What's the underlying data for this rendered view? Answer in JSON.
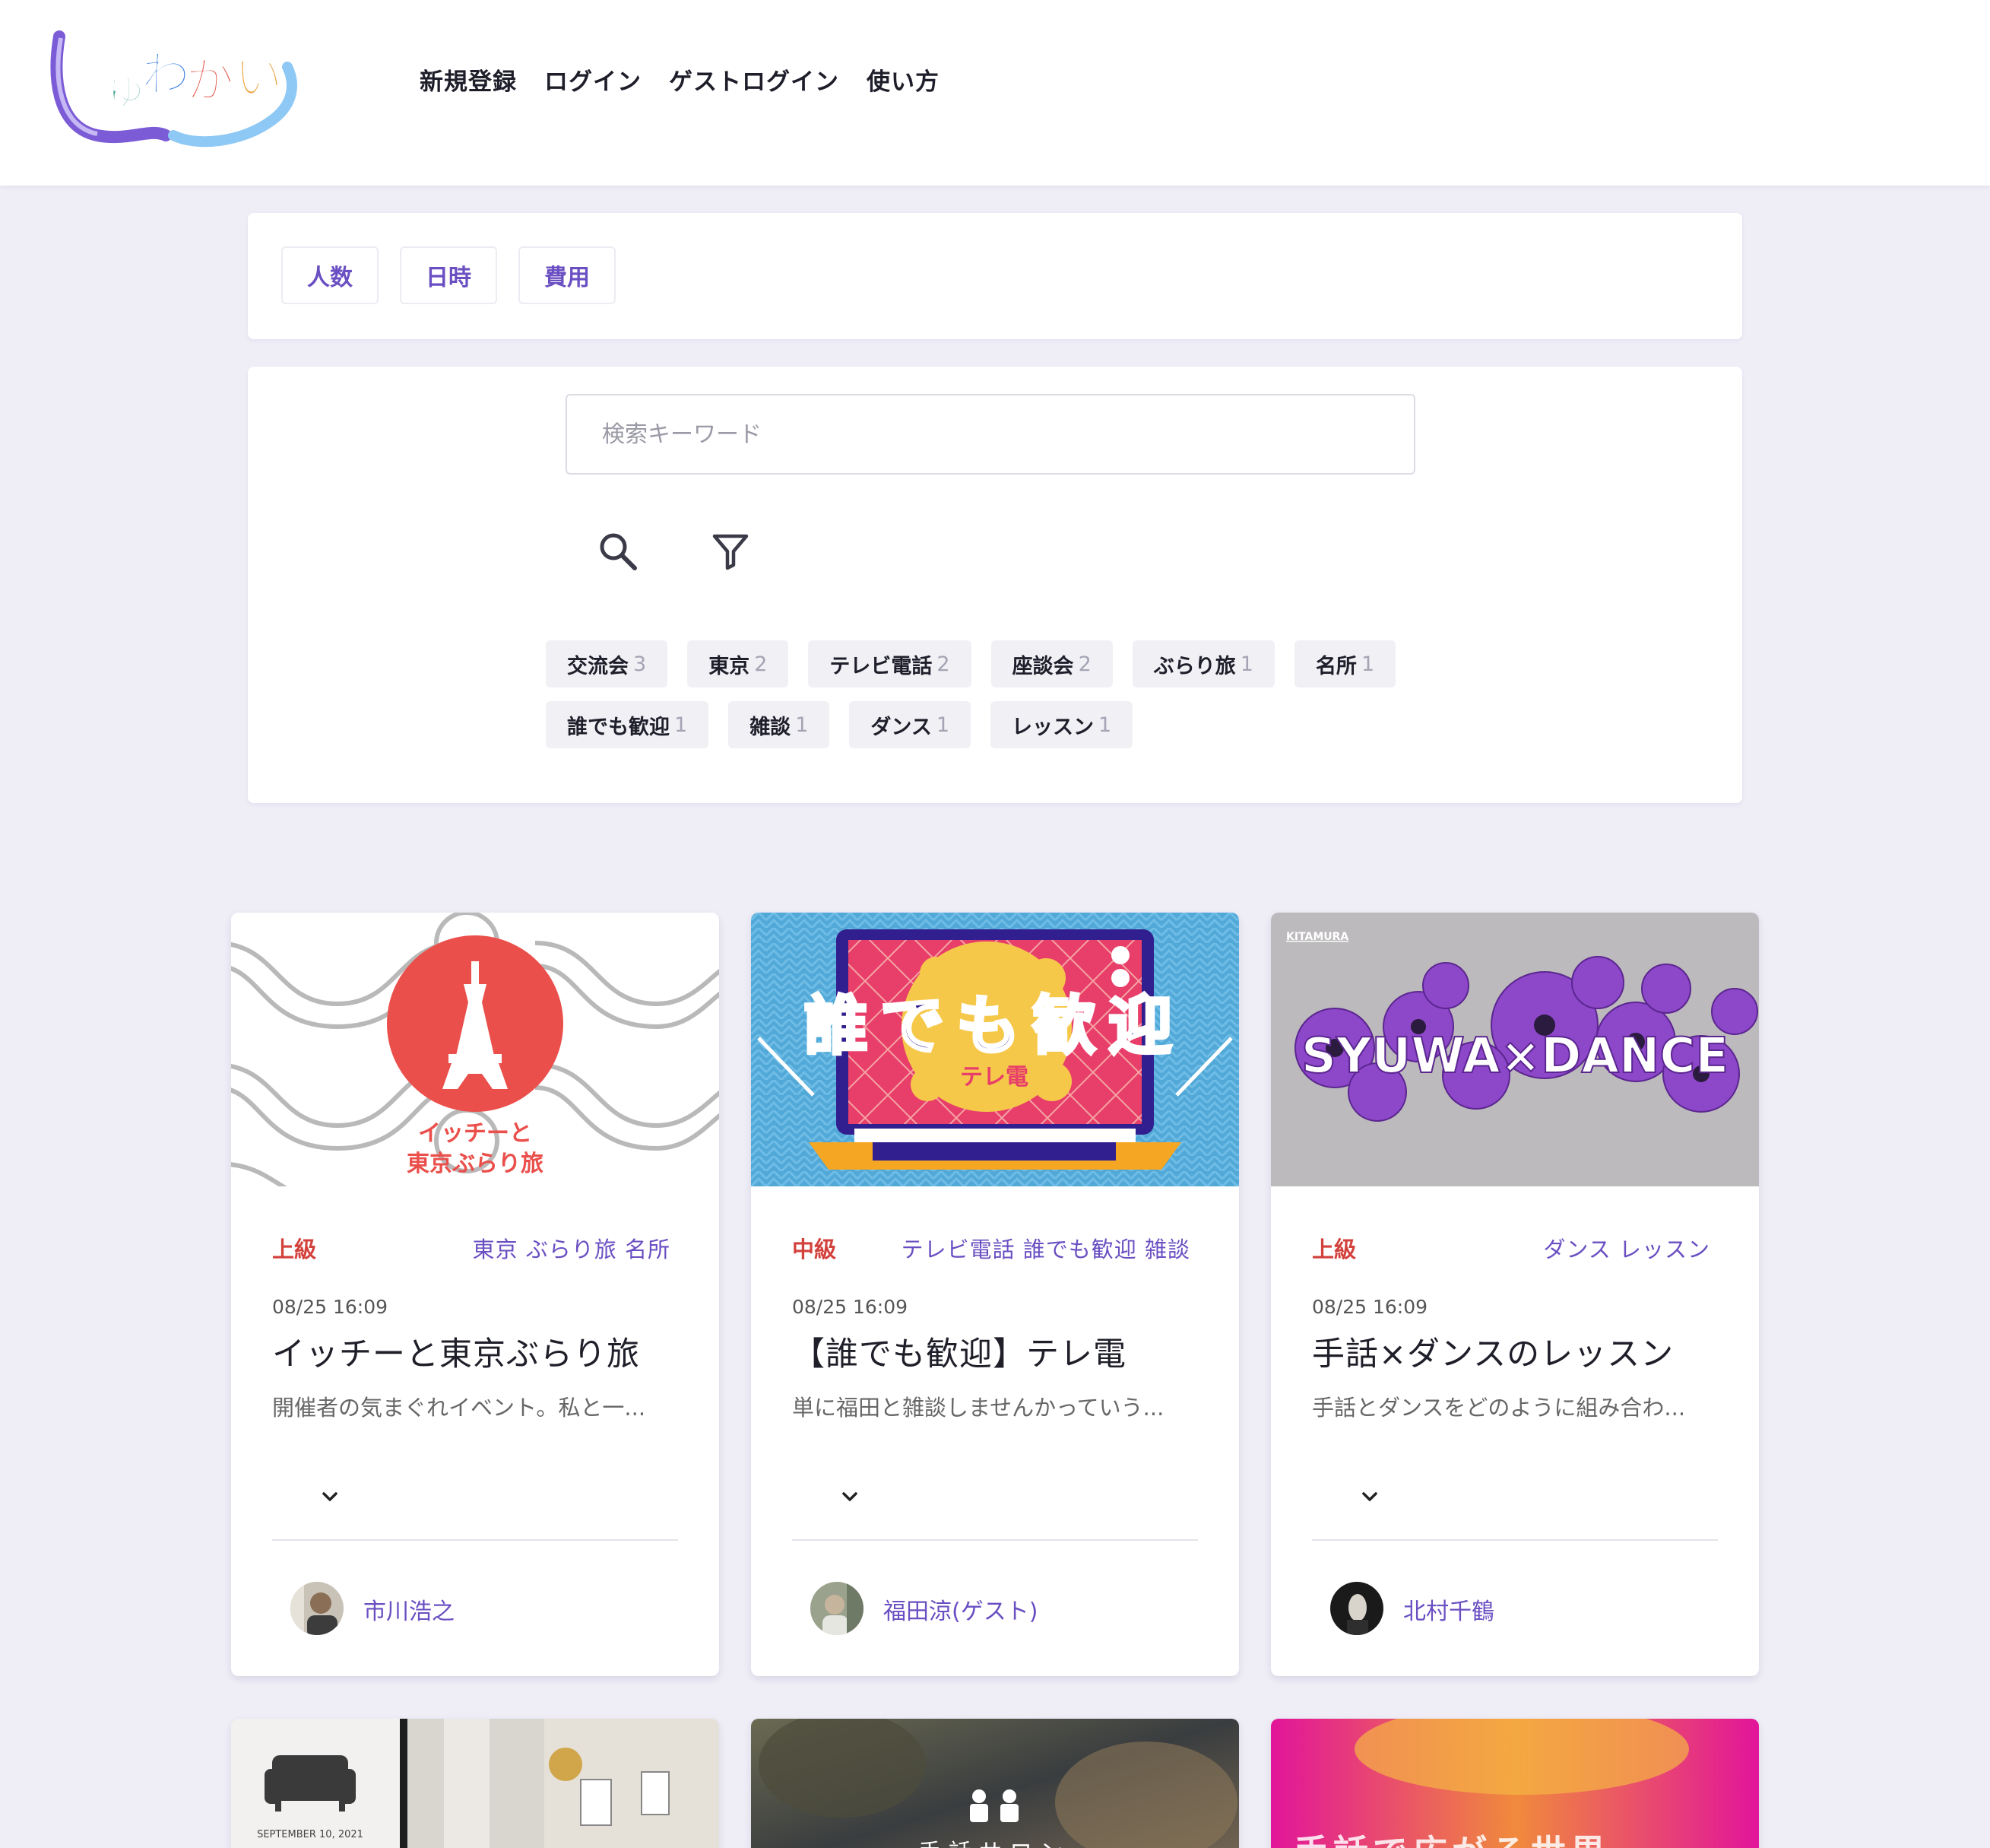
{
  "header": {
    "logo_text": "しゅわかい",
    "nav": [
      "新規登録",
      "ログイン",
      "ゲストログイン",
      "使い方"
    ]
  },
  "filters": {
    "buttons": [
      "人数",
      "日時",
      "費用"
    ]
  },
  "search": {
    "placeholder": "検索キーワード",
    "tags_row1": [
      {
        "name": "交流会",
        "count": "3"
      },
      {
        "name": "東京",
        "count": "2"
      },
      {
        "name": "テレビ電話",
        "count": "2"
      },
      {
        "name": "座談会",
        "count": "2"
      },
      {
        "name": "ぶらり旅",
        "count": "1"
      },
      {
        "name": "名所",
        "count": "1"
      }
    ],
    "tags_row2": [
      {
        "name": "誰でも歓迎",
        "count": "1"
      },
      {
        "name": "雑談",
        "count": "1"
      },
      {
        "name": "ダンス",
        "count": "1"
      },
      {
        "name": "レッスン",
        "count": "1"
      }
    ]
  },
  "cards": [
    {
      "level": "上級",
      "tags": "東京 ぶらり旅 名所",
      "date": "08/25 16:09",
      "title": "イッチーと東京ぶらり旅",
      "desc": "開催者の気まぐれイベント。私と一...",
      "author": "市川浩之",
      "image_text_line1": "イッチーと",
      "image_text_line2": "東京ぶらり旅"
    },
    {
      "level": "中級",
      "tags": "テレビ電話 誰でも歓迎 雑談",
      "date": "08/25 16:09",
      "title": "【誰でも歓迎】テレ電",
      "desc": "単に福田と雑談しませんかっていう...",
      "author": "福田涼(ゲスト)",
      "image_text_main": "誰でも歓迎",
      "image_text_sub": "テレ電"
    },
    {
      "level": "上級",
      "tags": "ダンス レッスン",
      "date": "08/25 16:09",
      "title": "手話×ダンスのレッスン",
      "desc": "手話とダンスをどのように組み合わ...",
      "author": "北村千鶴",
      "image_brand": "KITAMURA",
      "image_text_main": "SYUWA×DANCE"
    }
  ],
  "bottom_cards": {
    "card1_date": "SEPTEMBER 10, 2021",
    "card2_text": "手話サロン",
    "card3_text": "手話で広がる世界"
  },
  "colors": {
    "accent": "#6a4fc2",
    "level_red": "#d3413c",
    "background": "#efeef7"
  }
}
